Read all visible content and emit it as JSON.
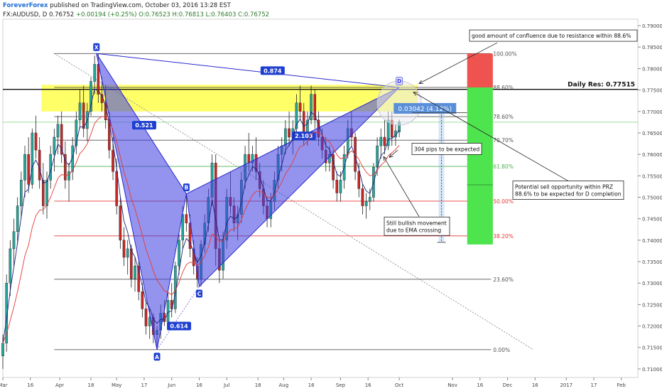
{
  "header": {
    "author": "ForeverForex",
    "published_text": "published on TradingView.com, October 03, 2016 13:28 EST",
    "symbol_line": "FX:AUDUSD, D  0.76752",
    "change": "+0.00194 (+0.25%)",
    "ohlc": "O:0.76523  H:0.76813  L:0.76403  C:0.76752"
  },
  "chart_data": {
    "type": "candlestick",
    "price_axis": {
      "ticks": [
        "0.79000",
        "0.78500",
        "0.78000",
        "0.77500",
        "0.77000",
        "0.76500",
        "0.76000",
        "0.75500",
        "0.75000",
        "0.74500",
        "0.74000",
        "0.73500",
        "0.73000",
        "0.72500",
        "0.72000",
        "0.71500",
        "0.71000"
      ],
      "range": [
        0.708,
        0.7915
      ]
    },
    "time_axis": {
      "ticks": [
        {
          "label": "Mar",
          "date": "2016-03-01"
        },
        {
          "label": "16",
          "date": "2016-03-16"
        },
        {
          "label": "Apr",
          "date": "2016-04-01"
        },
        {
          "label": "18",
          "date": "2016-04-18"
        },
        {
          "label": "May",
          "date": "2016-05-02"
        },
        {
          "label": "17",
          "date": "2016-05-17"
        },
        {
          "label": "Jun",
          "date": "2016-06-01"
        },
        {
          "label": "16",
          "date": "2016-06-16"
        },
        {
          "label": "Jul",
          "date": "2016-07-01"
        },
        {
          "label": "18",
          "date": "2016-07-18"
        },
        {
          "label": "Aug",
          "date": "2016-08-01"
        },
        {
          "label": "16",
          "date": "2016-08-16"
        },
        {
          "label": "Sep",
          "date": "2016-09-01"
        },
        {
          "label": "16",
          "date": "2016-09-16"
        },
        {
          "label": "Oct",
          "date": "2016-10-03"
        },
        {
          "label": "Nov",
          "date": "2016-11-01"
        },
        {
          "label": "16",
          "date": "2016-11-16"
        },
        {
          "label": "Dec",
          "date": "2016-12-01"
        },
        {
          "label": "16",
          "date": "2016-12-16"
        },
        {
          "label": "2017",
          "date": "2017-01-02"
        },
        {
          "label": "17",
          "date": "2017-01-17"
        },
        {
          "label": "Feb",
          "date": "2017-02-01"
        }
      ]
    },
    "fib_levels": [
      {
        "label": "100.00%",
        "price": 0.7835,
        "color": "#555555"
      },
      {
        "label": "88.60%",
        "price": 0.7756,
        "color": "#555555"
      },
      {
        "label": "78.60%",
        "price": 0.7688,
        "color": "#555555"
      },
      {
        "label": "70.70%",
        "price": 0.7633,
        "color": "#555555"
      },
      {
        "label": "61.80%",
        "price": 0.7572,
        "color": "#4caf50"
      },
      {
        "label": "50.00%",
        "price": 0.7491,
        "color": "#e53935"
      },
      {
        "label": "38.20%",
        "price": 0.741,
        "color": "#e53935"
      },
      {
        "label": "23.60%",
        "price": 0.7309,
        "color": "#555555"
      },
      {
        "label": "0.00%",
        "price": 0.7145,
        "color": "#555555"
      }
    ],
    "resistance": {
      "label": "Daily Res: 0.77515",
      "price": 0.77515
    },
    "prz_zone": {
      "top": 0.7762,
      "bottom": 0.77
    },
    "pattern_points": [
      {
        "label": "X",
        "date": "2016-04-21",
        "price": 0.7835
      },
      {
        "label": "A",
        "date": "2016-05-24",
        "price": 0.7145
      },
      {
        "label": "B",
        "date": "2016-06-09",
        "price": 0.7508
      },
      {
        "label": "C",
        "date": "2016-06-16",
        "price": 0.7292
      },
      {
        "label": "D",
        "date": "2016-10-03",
        "price": 0.7756
      }
    ],
    "ratios": [
      {
        "label": "0.874",
        "date": "2016-07-26",
        "price": 0.7795
      },
      {
        "label": "0.521",
        "date": "2016-05-17",
        "price": 0.7668
      },
      {
        "label": "0.614",
        "date": "2016-06-05",
        "price": 0.72
      },
      {
        "label": "2.103",
        "date": "2016-08-12",
        "price": 0.7643
      }
    ],
    "measure": {
      "label": "0.03042 (4.12%)",
      "date": "2016-10-17",
      "price": 0.7708
    },
    "annotations": [
      {
        "text": "good amount of confluence due to resistance within 88.6%",
        "date": "2016-11-08",
        "price": 0.7871
      },
      {
        "text": "304 pips to be expected",
        "date": "2016-10-09",
        "price": 0.7609
      },
      {
        "text": "Potential sell opportunity within PRZ",
        "date": "2016-12-04",
        "price": 0.7518
      },
      {
        "text": "88.6% to be expected for D completion",
        "date": "2016-12-04",
        "price": 0.75
      },
      {
        "text": "Still bullish movement",
        "date": "2016-09-23",
        "price": 0.7435
      },
      {
        "text": "due to EMA crossing",
        "date": "2016-09-23",
        "price": 0.7417
      }
    ],
    "colors": {
      "up": "#26a69a",
      "down": "#c62828",
      "pattern_fill": "#3d3de0",
      "pattern_line": "#2a2ad0",
      "prz": "#ffff4d",
      "ema_fast": "#1a237e",
      "ema_slow": "#e53935",
      "sell_red": "#ef5350",
      "sell_green": "#4ee44e",
      "measure_blue": "#90b8e8"
    },
    "candles": [
      {
        "d": "2016-03-01",
        "o": 0.713,
        "h": 0.718,
        "l": 0.71,
        "c": 0.716
      },
      {
        "d": "2016-03-03",
        "o": 0.716,
        "h": 0.732,
        "l": 0.714,
        "c": 0.73
      },
      {
        "d": "2016-03-05",
        "o": 0.73,
        "h": 0.74,
        "l": 0.727,
        "c": 0.738
      },
      {
        "d": "2016-03-07",
        "o": 0.738,
        "h": 0.745,
        "l": 0.734,
        "c": 0.742
      },
      {
        "d": "2016-03-09",
        "o": 0.742,
        "h": 0.75,
        "l": 0.739,
        "c": 0.748
      },
      {
        "d": "2016-03-11",
        "o": 0.748,
        "h": 0.756,
        "l": 0.745,
        "c": 0.754
      },
      {
        "d": "2016-03-13",
        "o": 0.754,
        "h": 0.762,
        "l": 0.75,
        "c": 0.76
      },
      {
        "d": "2016-03-15",
        "o": 0.76,
        "h": 0.764,
        "l": 0.751,
        "c": 0.753
      },
      {
        "d": "2016-03-17",
        "o": 0.753,
        "h": 0.766,
        "l": 0.752,
        "c": 0.765
      },
      {
        "d": "2016-03-19",
        "o": 0.765,
        "h": 0.769,
        "l": 0.759,
        "c": 0.761
      },
      {
        "d": "2016-03-21",
        "o": 0.761,
        "h": 0.764,
        "l": 0.752,
        "c": 0.754
      },
      {
        "d": "2016-03-23",
        "o": 0.754,
        "h": 0.758,
        "l": 0.746,
        "c": 0.748
      },
      {
        "d": "2016-03-25",
        "o": 0.748,
        "h": 0.756,
        "l": 0.745,
        "c": 0.754
      },
      {
        "d": "2016-03-27",
        "o": 0.754,
        "h": 0.762,
        "l": 0.752,
        "c": 0.76
      },
      {
        "d": "2016-03-29",
        "o": 0.76,
        "h": 0.766,
        "l": 0.756,
        "c": 0.764
      },
      {
        "d": "2016-03-31",
        "o": 0.764,
        "h": 0.769,
        "l": 0.76,
        "c": 0.767
      },
      {
        "d": "2016-04-02",
        "o": 0.767,
        "h": 0.77,
        "l": 0.758,
        "c": 0.76
      },
      {
        "d": "2016-04-04",
        "o": 0.76,
        "h": 0.763,
        "l": 0.752,
        "c": 0.754
      },
      {
        "d": "2016-04-06",
        "o": 0.754,
        "h": 0.758,
        "l": 0.749,
        "c": 0.756
      },
      {
        "d": "2016-04-08",
        "o": 0.756,
        "h": 0.764,
        "l": 0.754,
        "c": 0.762
      },
      {
        "d": "2016-04-10",
        "o": 0.762,
        "h": 0.77,
        "l": 0.76,
        "c": 0.768
      },
      {
        "d": "2016-04-12",
        "o": 0.768,
        "h": 0.775,
        "l": 0.766,
        "c": 0.772
      },
      {
        "d": "2016-04-14",
        "o": 0.772,
        "h": 0.776,
        "l": 0.764,
        "c": 0.766
      },
      {
        "d": "2016-04-16",
        "o": 0.766,
        "h": 0.772,
        "l": 0.763,
        "c": 0.77
      },
      {
        "d": "2016-04-18",
        "o": 0.77,
        "h": 0.778,
        "l": 0.769,
        "c": 0.777
      },
      {
        "d": "2016-04-20",
        "o": 0.777,
        "h": 0.783,
        "l": 0.774,
        "c": 0.781
      },
      {
        "d": "2016-04-22",
        "o": 0.781,
        "h": 0.7835,
        "l": 0.772,
        "c": 0.774
      },
      {
        "d": "2016-04-24",
        "o": 0.774,
        "h": 0.778,
        "l": 0.77,
        "c": 0.772
      },
      {
        "d": "2016-04-26",
        "o": 0.772,
        "h": 0.776,
        "l": 0.766,
        "c": 0.768
      },
      {
        "d": "2016-04-28",
        "o": 0.768,
        "h": 0.77,
        "l": 0.759,
        "c": 0.761
      },
      {
        "d": "2016-04-30",
        "o": 0.761,
        "h": 0.764,
        "l": 0.754,
        "c": 0.756
      },
      {
        "d": "2016-05-02",
        "o": 0.756,
        "h": 0.759,
        "l": 0.746,
        "c": 0.748
      },
      {
        "d": "2016-05-04",
        "o": 0.748,
        "h": 0.75,
        "l": 0.738,
        "c": 0.74
      },
      {
        "d": "2016-05-06",
        "o": 0.74,
        "h": 0.743,
        "l": 0.734,
        "c": 0.736
      },
      {
        "d": "2016-05-08",
        "o": 0.736,
        "h": 0.74,
        "l": 0.732,
        "c": 0.738
      },
      {
        "d": "2016-05-10",
        "o": 0.738,
        "h": 0.739,
        "l": 0.729,
        "c": 0.731
      },
      {
        "d": "2016-05-12",
        "o": 0.731,
        "h": 0.736,
        "l": 0.728,
        "c": 0.734
      },
      {
        "d": "2016-05-14",
        "o": 0.734,
        "h": 0.735,
        "l": 0.726,
        "c": 0.728
      },
      {
        "d": "2016-05-16",
        "o": 0.728,
        "h": 0.73,
        "l": 0.722,
        "c": 0.724
      },
      {
        "d": "2016-05-18",
        "o": 0.724,
        "h": 0.726,
        "l": 0.718,
        "c": 0.72
      },
      {
        "d": "2016-05-20",
        "o": 0.72,
        "h": 0.724,
        "l": 0.717,
        "c": 0.722
      },
      {
        "d": "2016-05-22",
        "o": 0.722,
        "h": 0.723,
        "l": 0.716,
        "c": 0.718
      },
      {
        "d": "2016-05-24",
        "o": 0.718,
        "h": 0.72,
        "l": 0.7145,
        "c": 0.719
      },
      {
        "d": "2016-05-26",
        "o": 0.719,
        "h": 0.725,
        "l": 0.717,
        "c": 0.723
      },
      {
        "d": "2016-05-28",
        "o": 0.723,
        "h": 0.726,
        "l": 0.72,
        "c": 0.721
      },
      {
        "d": "2016-05-30",
        "o": 0.721,
        "h": 0.728,
        "l": 0.719,
        "c": 0.726
      },
      {
        "d": "2016-06-01",
        "o": 0.726,
        "h": 0.73,
        "l": 0.722,
        "c": 0.724
      },
      {
        "d": "2016-06-03",
        "o": 0.724,
        "h": 0.735,
        "l": 0.723,
        "c": 0.734
      },
      {
        "d": "2016-06-05",
        "o": 0.734,
        "h": 0.742,
        "l": 0.732,
        "c": 0.74
      },
      {
        "d": "2016-06-07",
        "o": 0.74,
        "h": 0.748,
        "l": 0.738,
        "c": 0.746
      },
      {
        "d": "2016-06-09",
        "o": 0.746,
        "h": 0.7508,
        "l": 0.742,
        "c": 0.744
      },
      {
        "d": "2016-06-11",
        "o": 0.744,
        "h": 0.746,
        "l": 0.736,
        "c": 0.738
      },
      {
        "d": "2016-06-13",
        "o": 0.738,
        "h": 0.74,
        "l": 0.732,
        "c": 0.734
      },
      {
        "d": "2016-06-15",
        "o": 0.734,
        "h": 0.736,
        "l": 0.729,
        "c": 0.731
      },
      {
        "d": "2016-06-17",
        "o": 0.731,
        "h": 0.74,
        "l": 0.7292,
        "c": 0.739
      },
      {
        "d": "2016-06-19",
        "o": 0.739,
        "h": 0.746,
        "l": 0.737,
        "c": 0.744
      },
      {
        "d": "2016-06-21",
        "o": 0.744,
        "h": 0.752,
        "l": 0.742,
        "c": 0.75
      },
      {
        "d": "2016-06-23",
        "o": 0.75,
        "h": 0.76,
        "l": 0.748,
        "c": 0.758
      },
      {
        "d": "2016-06-25",
        "o": 0.758,
        "h": 0.76,
        "l": 0.734,
        "c": 0.738
      },
      {
        "d": "2016-06-27",
        "o": 0.738,
        "h": 0.74,
        "l": 0.73,
        "c": 0.733
      },
      {
        "d": "2016-06-29",
        "o": 0.733,
        "h": 0.742,
        "l": 0.731,
        "c": 0.74
      },
      {
        "d": "2016-07-01",
        "o": 0.74,
        "h": 0.752,
        "l": 0.738,
        "c": 0.75
      },
      {
        "d": "2016-07-03",
        "o": 0.75,
        "h": 0.756,
        "l": 0.746,
        "c": 0.748
      },
      {
        "d": "2016-07-05",
        "o": 0.748,
        "h": 0.75,
        "l": 0.742,
        "c": 0.744
      },
      {
        "d": "2016-07-07",
        "o": 0.744,
        "h": 0.748,
        "l": 0.74,
        "c": 0.746
      },
      {
        "d": "2016-07-09",
        "o": 0.746,
        "h": 0.756,
        "l": 0.744,
        "c": 0.754
      },
      {
        "d": "2016-07-11",
        "o": 0.754,
        "h": 0.762,
        "l": 0.752,
        "c": 0.76
      },
      {
        "d": "2016-07-13",
        "o": 0.76,
        "h": 0.765,
        "l": 0.756,
        "c": 0.758
      },
      {
        "d": "2016-07-15",
        "o": 0.758,
        "h": 0.762,
        "l": 0.756,
        "c": 0.76
      },
      {
        "d": "2016-07-17",
        "o": 0.76,
        "h": 0.764,
        "l": 0.754,
        "c": 0.756
      },
      {
        "d": "2016-07-19",
        "o": 0.756,
        "h": 0.758,
        "l": 0.75,
        "c": 0.752
      },
      {
        "d": "2016-07-21",
        "o": 0.752,
        "h": 0.754,
        "l": 0.746,
        "c": 0.748
      },
      {
        "d": "2016-07-23",
        "o": 0.748,
        "h": 0.75,
        "l": 0.743,
        "c": 0.745
      },
      {
        "d": "2016-07-25",
        "o": 0.745,
        "h": 0.751,
        "l": 0.743,
        "c": 0.749
      },
      {
        "d": "2016-07-27",
        "o": 0.749,
        "h": 0.756,
        "l": 0.747,
        "c": 0.754
      },
      {
        "d": "2016-07-29",
        "o": 0.754,
        "h": 0.762,
        "l": 0.752,
        "c": 0.76
      },
      {
        "d": "2016-07-31",
        "o": 0.76,
        "h": 0.764,
        "l": 0.756,
        "c": 0.762
      },
      {
        "d": "2016-08-02",
        "o": 0.762,
        "h": 0.768,
        "l": 0.76,
        "c": 0.766
      },
      {
        "d": "2016-08-04",
        "o": 0.766,
        "h": 0.77,
        "l": 0.762,
        "c": 0.764
      },
      {
        "d": "2016-08-06",
        "o": 0.764,
        "h": 0.768,
        "l": 0.76,
        "c": 0.766
      },
      {
        "d": "2016-08-08",
        "o": 0.766,
        "h": 0.774,
        "l": 0.765,
        "c": 0.772
      },
      {
        "d": "2016-08-10",
        "o": 0.772,
        "h": 0.776,
        "l": 0.768,
        "c": 0.77
      },
      {
        "d": "2016-08-12",
        "o": 0.77,
        "h": 0.772,
        "l": 0.762,
        "c": 0.764
      },
      {
        "d": "2016-08-14",
        "o": 0.764,
        "h": 0.77,
        "l": 0.762,
        "c": 0.768
      },
      {
        "d": "2016-08-16",
        "o": 0.768,
        "h": 0.776,
        "l": 0.767,
        "c": 0.774
      },
      {
        "d": "2016-08-18",
        "o": 0.774,
        "h": 0.775,
        "l": 0.766,
        "c": 0.768
      },
      {
        "d": "2016-08-20",
        "o": 0.768,
        "h": 0.77,
        "l": 0.762,
        "c": 0.764
      },
      {
        "d": "2016-08-22",
        "o": 0.764,
        "h": 0.766,
        "l": 0.759,
        "c": 0.761
      },
      {
        "d": "2016-08-24",
        "o": 0.761,
        "h": 0.764,
        "l": 0.756,
        "c": 0.758
      },
      {
        "d": "2016-08-26",
        "o": 0.758,
        "h": 0.762,
        "l": 0.756,
        "c": 0.76
      },
      {
        "d": "2016-08-28",
        "o": 0.76,
        "h": 0.761,
        "l": 0.752,
        "c": 0.754
      },
      {
        "d": "2016-08-30",
        "o": 0.754,
        "h": 0.756,
        "l": 0.749,
        "c": 0.751
      },
      {
        "d": "2016-09-01",
        "o": 0.751,
        "h": 0.756,
        "l": 0.749,
        "c": 0.754
      },
      {
        "d": "2016-09-03",
        "o": 0.754,
        "h": 0.762,
        "l": 0.752,
        "c": 0.76
      },
      {
        "d": "2016-09-05",
        "o": 0.76,
        "h": 0.768,
        "l": 0.759,
        "c": 0.766
      },
      {
        "d": "2016-09-07",
        "o": 0.766,
        "h": 0.77,
        "l": 0.762,
        "c": 0.764
      },
      {
        "d": "2016-09-09",
        "o": 0.764,
        "h": 0.765,
        "l": 0.754,
        "c": 0.756
      },
      {
        "d": "2016-09-11",
        "o": 0.756,
        "h": 0.758,
        "l": 0.75,
        "c": 0.752
      },
      {
        "d": "2016-09-13",
        "o": 0.752,
        "h": 0.753,
        "l": 0.746,
        "c": 0.748
      },
      {
        "d": "2016-09-15",
        "o": 0.748,
        "h": 0.751,
        "l": 0.745,
        "c": 0.749
      },
      {
        "d": "2016-09-17",
        "o": 0.749,
        "h": 0.752,
        "l": 0.747,
        "c": 0.75
      },
      {
        "d": "2016-09-19",
        "o": 0.75,
        "h": 0.758,
        "l": 0.749,
        "c": 0.757
      },
      {
        "d": "2016-09-21",
        "o": 0.757,
        "h": 0.764,
        "l": 0.755,
        "c": 0.762
      },
      {
        "d": "2016-09-23",
        "o": 0.762,
        "h": 0.766,
        "l": 0.759,
        "c": 0.764
      },
      {
        "d": "2016-09-25",
        "o": 0.764,
        "h": 0.768,
        "l": 0.76,
        "c": 0.762
      },
      {
        "d": "2016-09-27",
        "o": 0.762,
        "h": 0.77,
        "l": 0.761,
        "c": 0.768
      },
      {
        "d": "2016-09-29",
        "o": 0.768,
        "h": 0.77,
        "l": 0.762,
        "c": 0.764
      },
      {
        "d": "2016-10-01",
        "o": 0.764,
        "h": 0.767,
        "l": 0.762,
        "c": 0.7655
      },
      {
        "d": "2016-10-03",
        "o": 0.7652,
        "h": 0.7681,
        "l": 0.764,
        "c": 0.7675
      }
    ]
  }
}
